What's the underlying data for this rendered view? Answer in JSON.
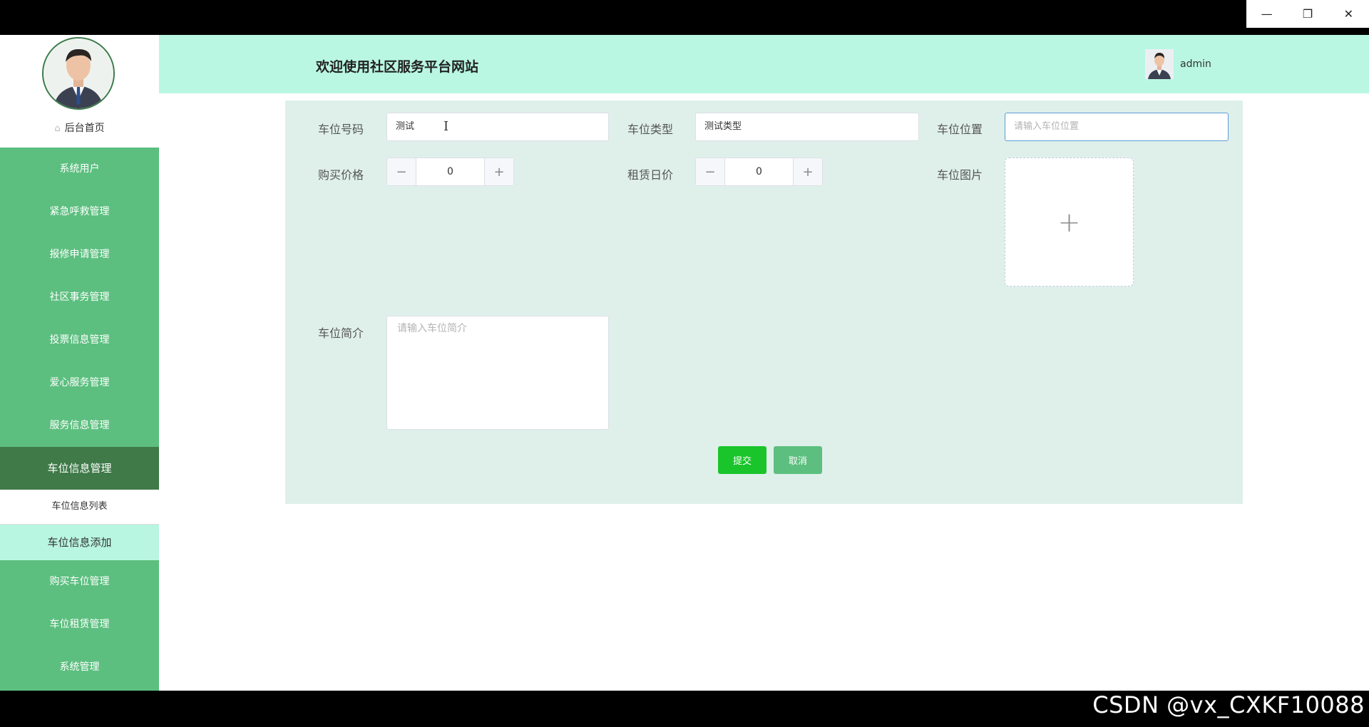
{
  "window": {
    "minimize_icon": "minimize-icon",
    "restore_icon": "restore-icon",
    "close_icon": "close-icon"
  },
  "sidebar": {
    "home_label": "后台首页",
    "items": [
      {
        "label": "系统用户"
      },
      {
        "label": "紧急呼救管理"
      },
      {
        "label": "报修申请管理"
      },
      {
        "label": "社区事务管理"
      },
      {
        "label": "投票信息管理"
      },
      {
        "label": "爱心服务管理"
      },
      {
        "label": "服务信息管理"
      },
      {
        "label": "车位信息管理",
        "active": true
      },
      {
        "label": "购买车位管理"
      },
      {
        "label": "车位租赁管理"
      },
      {
        "label": "系统管理"
      }
    ],
    "sub_items": [
      {
        "label": "车位信息列表"
      },
      {
        "label": "车位信息添加",
        "selected": true
      }
    ]
  },
  "header": {
    "title": "欢迎使用社区服务平台网站",
    "username": "admin"
  },
  "form": {
    "spot_number": {
      "label": "车位号码",
      "value": "测试"
    },
    "spot_type": {
      "label": "车位类型",
      "value": "测试类型"
    },
    "spot_location": {
      "label": "车位位置",
      "placeholder": "请输入车位位置"
    },
    "buy_price": {
      "label": "购买价格",
      "value": "0"
    },
    "daily_rent": {
      "label": "租赁日价",
      "value": "0"
    },
    "spot_image": {
      "label": "车位图片",
      "upload_icon": "+"
    },
    "spot_intro": {
      "label": "车位简介",
      "placeholder": "请输入车位简介"
    },
    "submit_label": "提交",
    "cancel_label": "取消"
  },
  "watermark": "CSDN @vx_CXKF10088",
  "colors": {
    "sidebar": "#5cbf7f",
    "sidebar_active": "#3f7a48",
    "header": "#b9f7e3",
    "panel": "#dff0ea",
    "submit": "#19c52a"
  }
}
